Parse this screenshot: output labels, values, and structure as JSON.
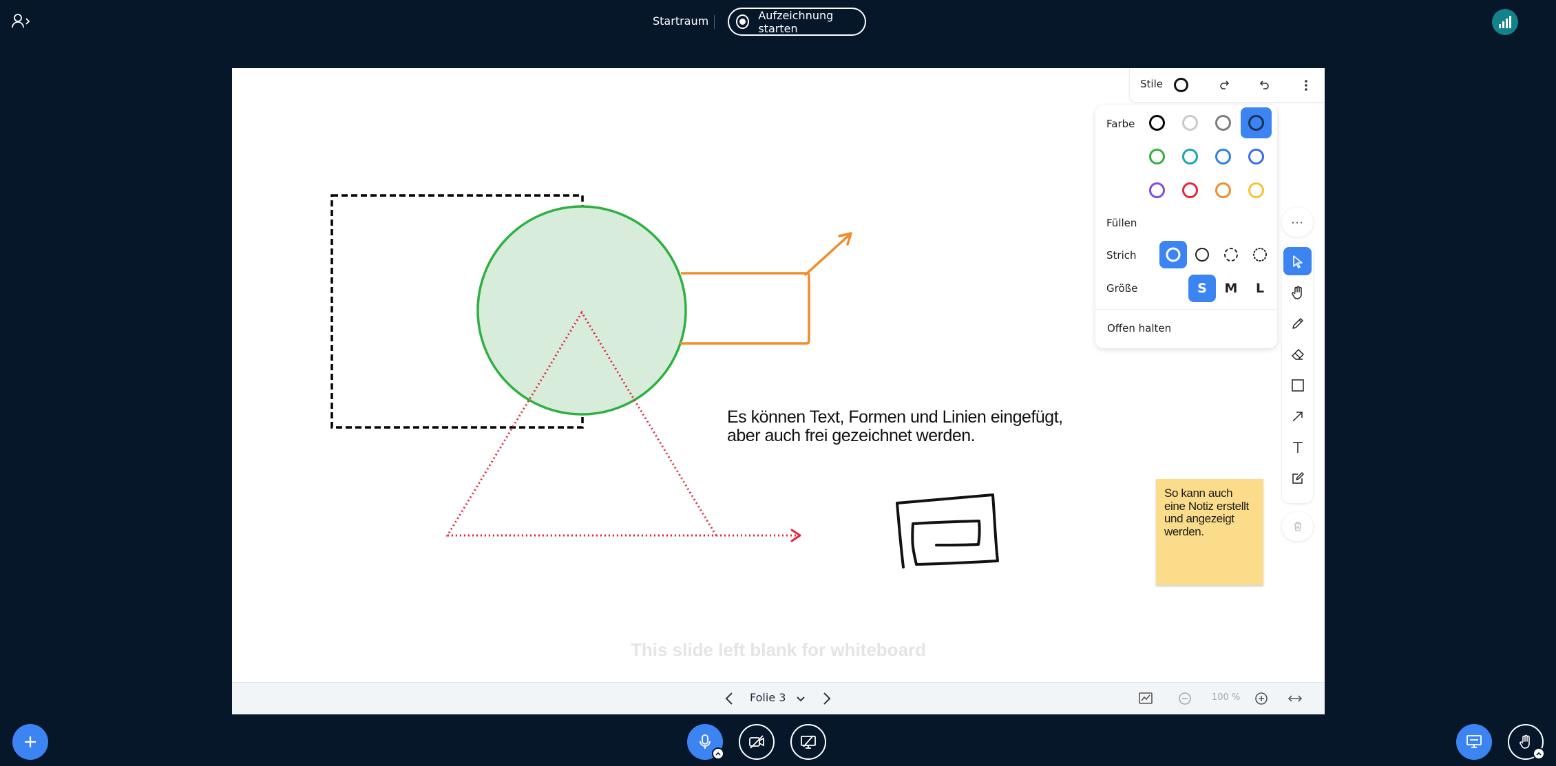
{
  "header": {
    "room_title": "Startraum",
    "record_label": "Aufzeichnung starten"
  },
  "whiteboard": {
    "main_text": "Es können Text, Formen und Linien eingefügt,\naber auch frei gezeichnet werden.",
    "note_text": "So kann auch eine Notiz erstellt und angezeigt werden.",
    "blank_slide_text": "This slide left blank for whiteboard"
  },
  "style_toolbar": {
    "label": "Stile"
  },
  "style_panel": {
    "color_label": "Farbe",
    "fill_label": "Füllen",
    "stroke_label": "Strich",
    "size_label": "Größe",
    "keep_open_label": "Offen halten",
    "colors": [
      "#000000",
      "#c9c9c9",
      "#7c7c7c",
      "#1d2f52",
      "#2fb043",
      "#1aa2b7",
      "#2f7fe0",
      "#3a6be8",
      "#7d4ce2",
      "#e5263a",
      "#f08c2a",
      "#f6c234"
    ],
    "selected_color_index": 3,
    "stroke_styles": [
      "draw",
      "solid",
      "dashed",
      "dotted"
    ],
    "selected_stroke_index": 0,
    "sizes": [
      "S",
      "M",
      "L"
    ],
    "selected_size": "S"
  },
  "tools": {
    "selected": "select-tool",
    "items": [
      "select-tool",
      "hand-tool",
      "draw-tool",
      "eraser-tool",
      "rectangle-tool",
      "arrow-tool",
      "text-tool",
      "note-tool"
    ]
  },
  "slide_bar": {
    "page_label": "Folie 3",
    "zoom_label": "100 %"
  },
  "colors": {
    "background": "#06172a",
    "accent": "#3d84f3",
    "note": "#fbdc8a",
    "circle_fill": "#d7ecdb",
    "circle_stroke": "#2fb043",
    "orange": "#f08c2a",
    "red": "#e5263a"
  }
}
